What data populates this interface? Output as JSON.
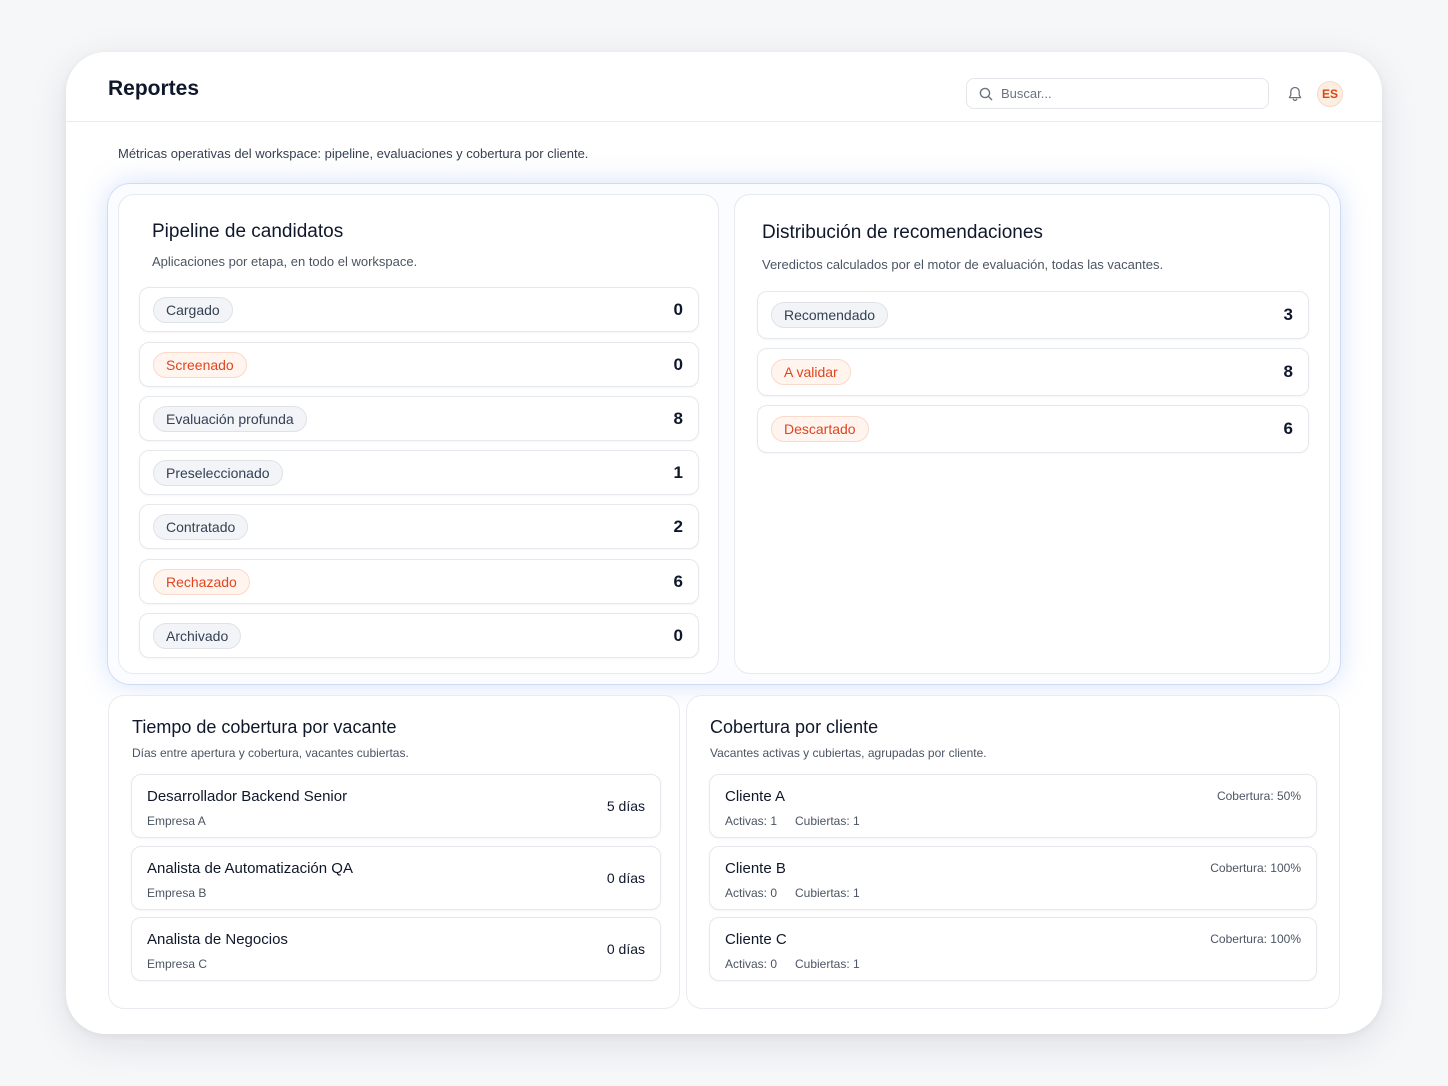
{
  "header": {
    "title": "Reportes",
    "search_placeholder": "Buscar...",
    "avatar_initials": "ES"
  },
  "page": {
    "subtitle": "Métricas operativas del workspace: pipeline, evaluaciones y cobertura por cliente."
  },
  "pipeline": {
    "title": "Pipeline de candidatos",
    "description": "Aplicaciones por etapa, en todo el workspace.",
    "stages": [
      {
        "label": "Cargado",
        "count": "0",
        "tone": "neutral"
      },
      {
        "label": "Screenado",
        "count": "0",
        "tone": "warn"
      },
      {
        "label": "Evaluación profunda",
        "count": "8",
        "tone": "neutral"
      },
      {
        "label": "Preseleccionado",
        "count": "1",
        "tone": "neutral"
      },
      {
        "label": "Contratado",
        "count": "2",
        "tone": "neutral"
      },
      {
        "label": "Rechazado",
        "count": "6",
        "tone": "warn"
      },
      {
        "label": "Archivado",
        "count": "0",
        "tone": "neutral"
      }
    ]
  },
  "recommendations": {
    "title": "Distribución de recomendaciones",
    "description": "Veredictos calculados por el motor de evaluación, todas las vacantes.",
    "items": [
      {
        "label": "Recomendado",
        "count": "3",
        "tone": "neutral"
      },
      {
        "label": "A validar",
        "count": "8",
        "tone": "warn"
      },
      {
        "label": "Descartado",
        "count": "6",
        "tone": "warn"
      }
    ]
  },
  "time_to_fill": {
    "title": "Tiempo de cobertura por vacante",
    "description": "Días entre apertura y cobertura, vacantes cubiertas.",
    "items": [
      {
        "title": "Desarrollador Backend Senior",
        "company": "Empresa A",
        "days": "5 días"
      },
      {
        "title": "Analista de Automatización QA",
        "company": "Empresa B",
        "days": "0 días"
      },
      {
        "title": "Analista de Negocios",
        "company": "Empresa C",
        "days": "0 días"
      }
    ]
  },
  "coverage": {
    "title": "Cobertura por cliente",
    "description": "Vacantes activas y cubiertas, agrupadas por cliente.",
    "items": [
      {
        "client": "Cliente A",
        "coverage": "Cobertura: 50%",
        "active": "Activas: 1",
        "covered": "Cubiertas: 1"
      },
      {
        "client": "Cliente B",
        "coverage": "Cobertura: 100%",
        "active": "Activas: 0",
        "covered": "Cubiertas: 1"
      },
      {
        "client": "Cliente C",
        "coverage": "Cobertura: 100%",
        "active": "Activas: 0",
        "covered": "Cubiertas: 1"
      }
    ]
  },
  "icons": {
    "search": "search-icon",
    "bell": "bell-icon"
  },
  "colors": {
    "accent_warn": "#e0451f",
    "avatar_bg": "#fdeee4",
    "glow": "#608deb"
  }
}
